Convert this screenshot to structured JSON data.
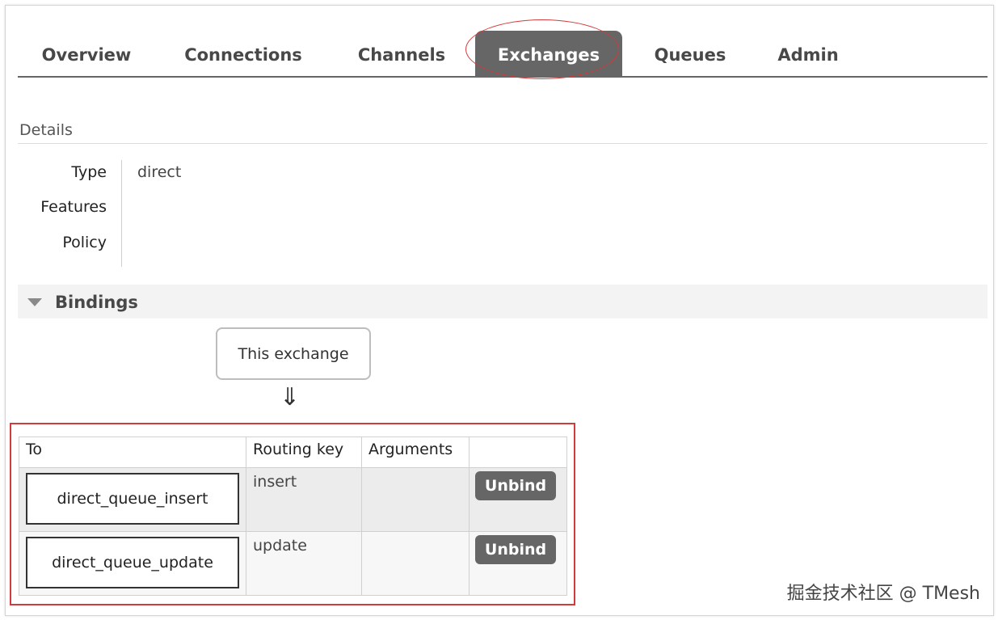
{
  "tabs": [
    "Overview",
    "Connections",
    "Channels",
    "Exchanges",
    "Queues",
    "Admin"
  ],
  "active_tab": "Exchanges",
  "details": {
    "title": "Details",
    "rows": [
      {
        "key": "Type",
        "value": "direct"
      },
      {
        "key": "Features",
        "value": ""
      },
      {
        "key": "Policy",
        "value": ""
      }
    ]
  },
  "bindings": {
    "title": "Bindings",
    "source_label": "This exchange",
    "arrow": "⇓",
    "columns": [
      "To",
      "Routing key",
      "Arguments",
      ""
    ],
    "rows": [
      {
        "to": "direct_queue_insert",
        "routing_key": "insert",
        "arguments": "",
        "action": "Unbind"
      },
      {
        "to": "direct_queue_update",
        "routing_key": "update",
        "arguments": "",
        "action": "Unbind"
      }
    ]
  },
  "watermark": "掘金技术社区 @ TMesh",
  "colors": {
    "tab_active_bg": "#666666",
    "highlight": "#d23b3b",
    "button_bg": "#666666"
  }
}
